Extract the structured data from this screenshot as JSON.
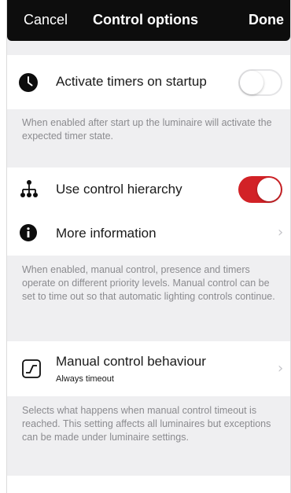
{
  "navbar": {
    "cancel_label": "Cancel",
    "title": "Control options",
    "done_label": "Done"
  },
  "timers": {
    "icon": "clock-icon",
    "label": "Activate timers on startup",
    "enabled": false,
    "footer": "When enabled after start up the luminaire will activate the expected timer state."
  },
  "hierarchy": {
    "icon": "hierarchy-icon",
    "label": "Use control hierarchy",
    "enabled": true,
    "accent_color": "#d22227"
  },
  "more_info": {
    "icon": "info-icon",
    "label": "More information",
    "chevron": "›",
    "footer": "When enabled, manual control, presence and timers operate on different priority levels. Manual control can be set to time out so that automatic lighting controls continue."
  },
  "manual": {
    "icon": "manual-control-icon",
    "label": "Manual control behaviour",
    "value": "Always timeout",
    "chevron": "›",
    "footer": "Selects what happens when manual control timeout is reached. This setting affects all luminaires but exceptions can be made under luminaire settings."
  }
}
